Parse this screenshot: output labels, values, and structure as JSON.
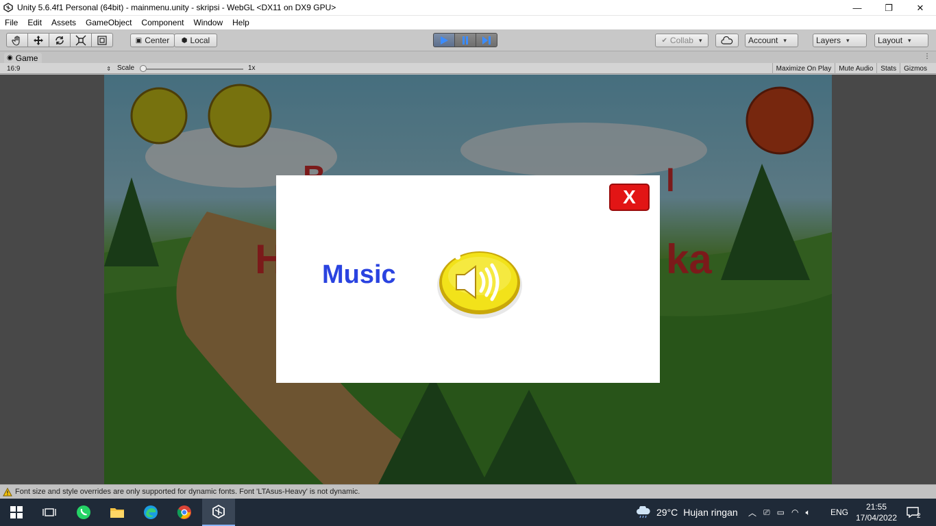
{
  "window": {
    "title": "Unity 5.6.4f1 Personal (64bit) - mainmenu.unity - skripsi - WebGL <DX11 on DX9 GPU>",
    "minimize": "—",
    "maximize": "❐",
    "close": "✕"
  },
  "menu": [
    "File",
    "Edit",
    "Assets",
    "GameObject",
    "Component",
    "Window",
    "Help"
  ],
  "toolbar": {
    "pivot": "Center",
    "space": "Local",
    "collab": "Collab",
    "account": "Account",
    "layers": "Layers",
    "layout": "Layout"
  },
  "game_tab": {
    "label": "Game",
    "aspect": "16:9",
    "scale_label": "Scale",
    "scale_value": "1x",
    "buttons": [
      "Maximize On Play",
      "Mute Audio",
      "Stats",
      "Gizmos"
    ]
  },
  "modal": {
    "close_label": "X",
    "music_label": "Music"
  },
  "status": {
    "message": "Font size and style overrides are only supported for dynamic fonts. Font 'LTAsus-Heavy' is not dynamic."
  },
  "taskbar": {
    "weather_temp": "29°C",
    "weather_desc": "Hujan ringan",
    "language": "ENG",
    "time": "21:55",
    "date": "17/04/2022",
    "notifications": "2"
  },
  "colors": {
    "accent_play": "#5d6f8d",
    "modal_close": "#e21515",
    "music_text": "#2a43e0",
    "sound_button": "#f2e21a"
  }
}
